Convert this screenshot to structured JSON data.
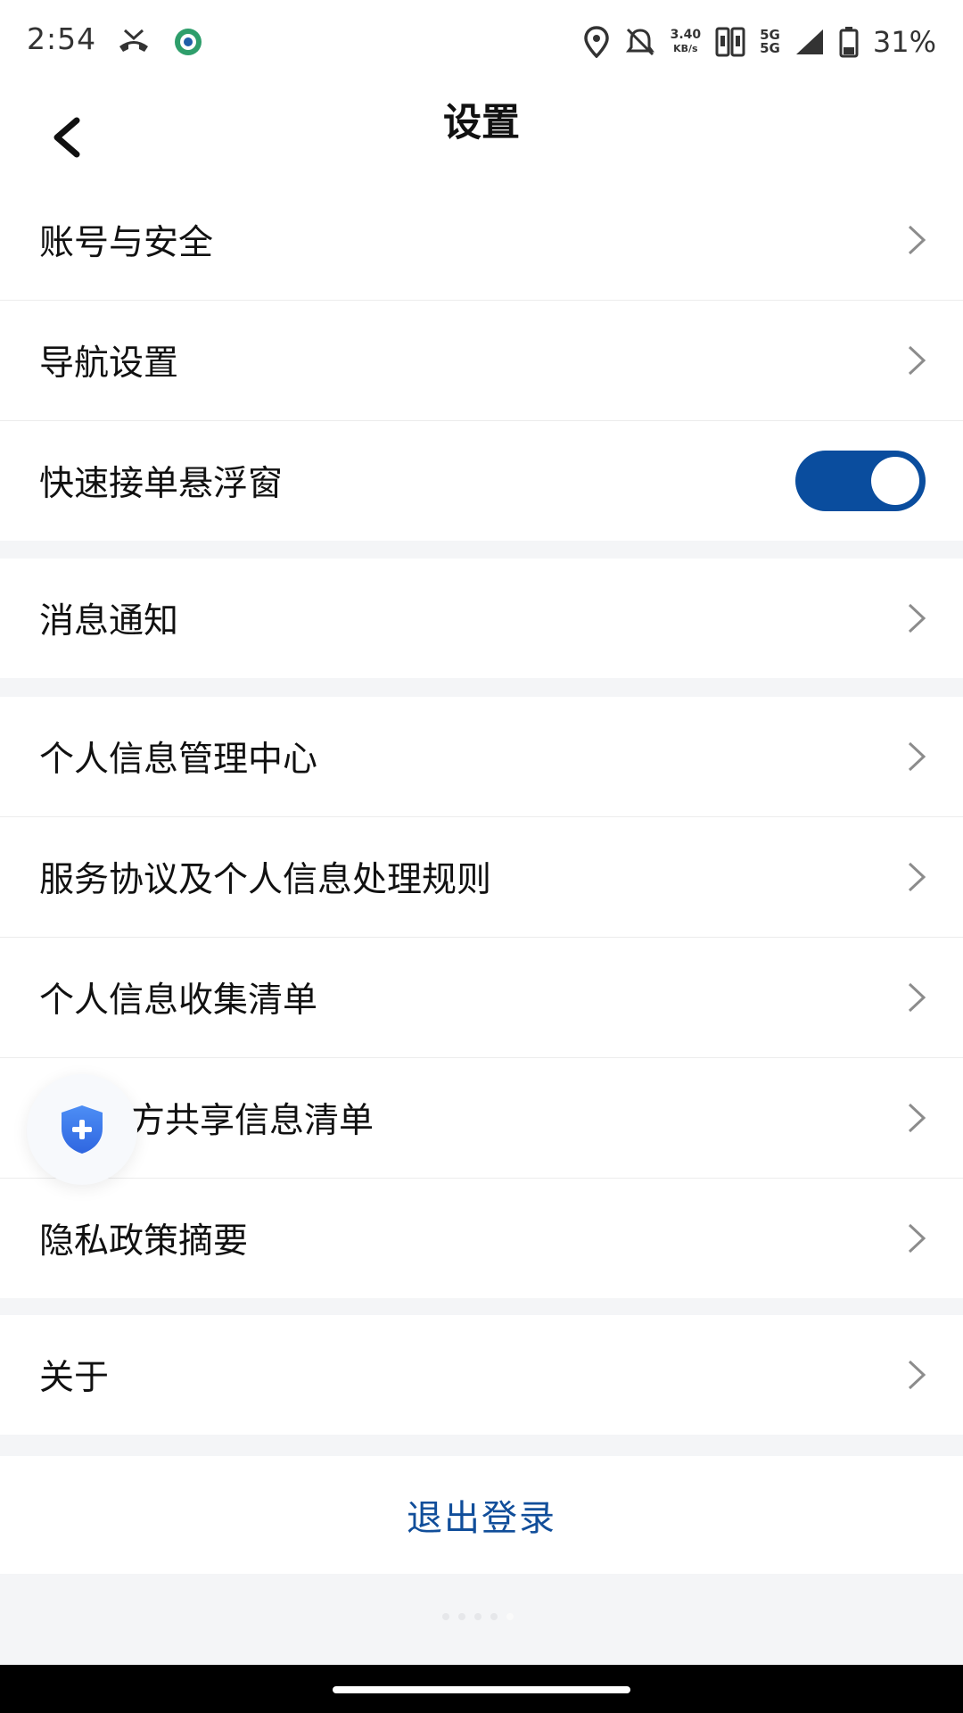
{
  "status_bar": {
    "time": "2:54",
    "speed_value": "3.40",
    "speed_unit": "KB/s",
    "net_top": "5G",
    "net_bottom": "5G",
    "battery": "31%",
    "icons": [
      "missed-call-icon",
      "app-notification-icon",
      "location-icon",
      "alarm-off-icon",
      "sim-icon",
      "signal-icon",
      "battery-icon"
    ]
  },
  "header": {
    "title": "设置",
    "back_icon": "back-arrow-icon"
  },
  "groups": [
    {
      "items": [
        {
          "label": "账号与安全",
          "control": "chevron"
        },
        {
          "label": "导航设置",
          "control": "chevron"
        },
        {
          "label": "快速接单悬浮窗",
          "control": "toggle",
          "toggle_on": true
        }
      ]
    },
    {
      "items": [
        {
          "label": "消息通知",
          "control": "chevron"
        }
      ]
    },
    {
      "items": [
        {
          "label": "个人信息管理中心",
          "control": "chevron"
        },
        {
          "label": "服务协议及个人信息处理规则",
          "control": "chevron"
        },
        {
          "label": "个人信息收集清单",
          "control": "chevron"
        },
        {
          "label": "与第三方共享信息清单",
          "visible_label": "方共享信息清单",
          "control": "chevron"
        },
        {
          "label": "隐私政策摘要",
          "control": "chevron"
        }
      ]
    },
    {
      "items": [
        {
          "label": "关于",
          "control": "chevron"
        }
      ]
    }
  ],
  "logout": {
    "label": "退出登录"
  },
  "floating_button": {
    "icon": "shield-plus-icon"
  },
  "colors": {
    "accent": "#0a4d9e",
    "logout_text": "#114e9a",
    "background": "#f4f5f7",
    "shield": "#3a7bf0"
  }
}
